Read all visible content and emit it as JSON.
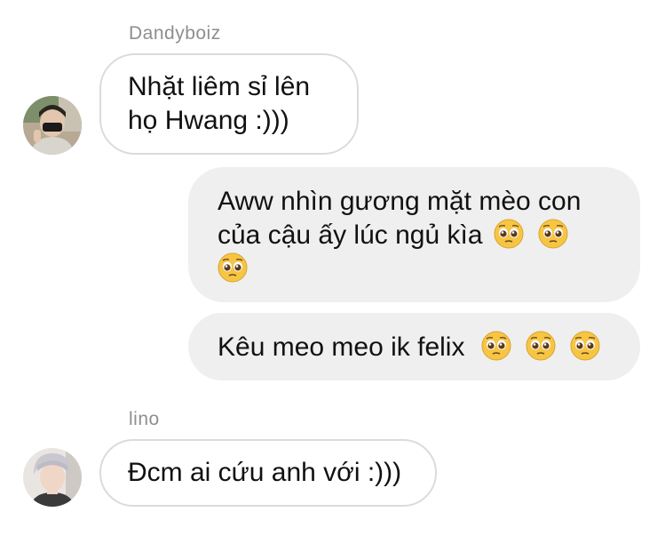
{
  "messages": [
    {
      "sender": "Dandyboiz",
      "direction": "incoming",
      "text_lines": [
        "Nhặt liêm sỉ lên",
        "họ Hwang :)))"
      ]
    },
    {
      "direction": "outgoing",
      "text_lines": [
        "Aww nhìn gương mặt mèo con",
        "của cậu ấy lúc ngủ kìa"
      ],
      "emoji": "pleading-face-emoji"
    },
    {
      "direction": "outgoing",
      "text": "Kêu meo meo ik felix",
      "emoji": "pleading-face-emoji"
    },
    {
      "sender": "lino",
      "direction": "incoming",
      "text": "Đcm ai cứu anh với :)))"
    }
  ],
  "colors": {
    "incoming_bubble_border": "#dbdbdb",
    "outgoing_bubble_bg": "#efefef",
    "sender_name": "#8e8e8e"
  }
}
